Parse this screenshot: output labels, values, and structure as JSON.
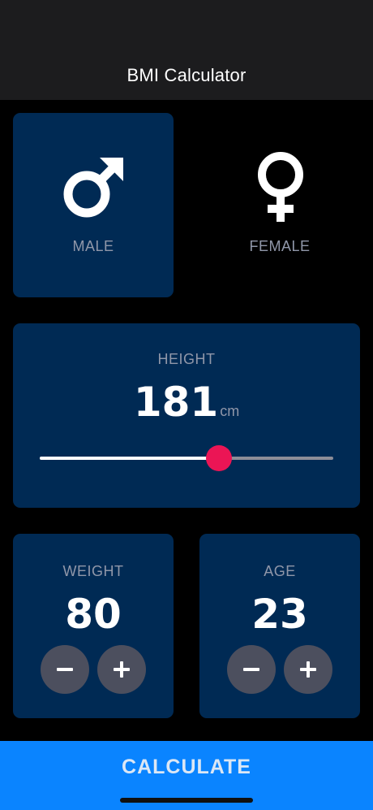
{
  "app": {
    "title": "BMI Calculator"
  },
  "gender": {
    "male": {
      "label": "MALE",
      "icon": "male-symbol-icon",
      "selected": true
    },
    "female": {
      "label": "FEMALE",
      "icon": "female-symbol-icon",
      "selected": false
    }
  },
  "height": {
    "label": "HEIGHT",
    "value": "181",
    "unit": "cm",
    "slider_fraction": 0.61
  },
  "weight": {
    "label": "WEIGHT",
    "value": "80",
    "decrement_icon": "minus-icon",
    "increment_icon": "plus-icon"
  },
  "age": {
    "label": "AGE",
    "value": "23",
    "decrement_icon": "minus-icon",
    "increment_icon": "plus-icon"
  },
  "calculate": {
    "label": "CALCULATE"
  },
  "colors": {
    "background": "#000000",
    "card_active": "#002a54",
    "accent": "#eb1555",
    "button_bar": "#0a84ff",
    "round_button": "#4c4f5e",
    "label_grey": "#9097a9"
  }
}
